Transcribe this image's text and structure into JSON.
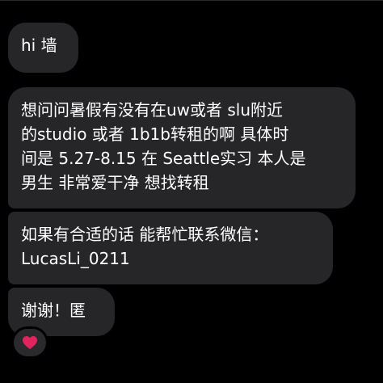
{
  "chat": {
    "messages": [
      {
        "lines": [
          "hi 墙"
        ]
      },
      {
        "lines": [
          "想问问暑假有没有在uw或者 slu附近",
          "的studio 或者 1b1b转租的啊 具体时",
          "间是 5.27-8.15 在 Seattle实习 本人是",
          "男生 非常爱干净 想找转租"
        ]
      },
      {
        "lines": [
          "如果有合适的话 能帮忙联系微信：",
          "LucasLi_0211"
        ]
      },
      {
        "lines": [
          "谢谢！匿"
        ]
      }
    ],
    "reaction": {
      "icon": "heart-icon",
      "color": "#e0245e"
    }
  },
  "colors": {
    "background": "#000000",
    "bubble": "#262629",
    "text": "#ffffff"
  }
}
